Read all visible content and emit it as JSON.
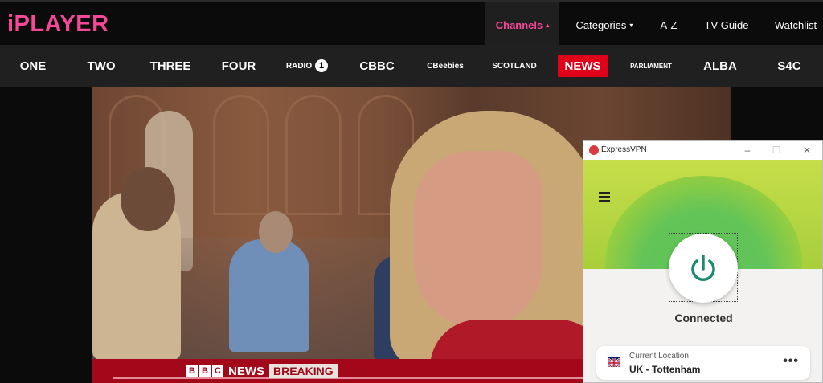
{
  "header": {
    "logo": "iPLAYER",
    "nav": [
      {
        "label": "Channels",
        "caret": "▴"
      },
      {
        "label": "Categories",
        "caret": "▾"
      },
      {
        "label": "A-Z"
      },
      {
        "label": "TV Guide"
      },
      {
        "label": "Watchlist"
      }
    ]
  },
  "channels": [
    "ONE",
    "TWO",
    "THREE",
    "FOUR",
    "RADIO",
    "1",
    "CBBC",
    "CBeebies",
    "SCOTLAND",
    "NEWS",
    "PARLIAMENT",
    "ALBA",
    "S4C"
  ],
  "video": {
    "ticker": {
      "bbc": [
        "B",
        "B",
        "C"
      ],
      "news": "NEWS",
      "breaking": "BREAKING"
    }
  },
  "vpn": {
    "title": "ExpressVPN",
    "status": "Connected",
    "location_label": "Current Location",
    "location_value": "UK - Tottenham",
    "more": "•••",
    "colors": {
      "accent": "#1c8a6e",
      "hero": "#a7cf3a",
      "brand": "#da3940"
    }
  },
  "colors": {
    "iplayer_pink": "#f54997",
    "news_red": "#e1001a",
    "ticker_red": "#a2081a"
  }
}
